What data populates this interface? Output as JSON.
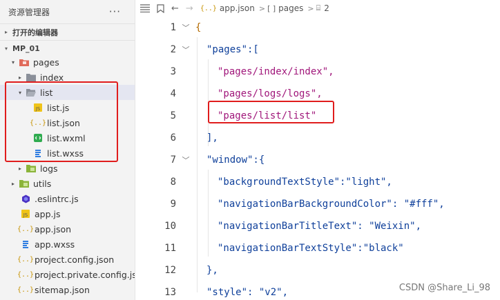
{
  "sidebar": {
    "title": "资源管理器",
    "more": "···",
    "open_editors": "打开的编辑器",
    "project": "MP_01",
    "tree": [
      {
        "label": "pages",
        "expanded": true,
        "icon": "folder-red-icon",
        "chev": "▾"
      },
      {
        "label": "index",
        "expanded": false,
        "icon": "folder-gray-icon",
        "chev": "▸"
      },
      {
        "label": "list",
        "expanded": true,
        "icon": "folder-gray-open-icon",
        "chev": "▾",
        "selected": true
      },
      {
        "label": "list.js",
        "icon": "js-file-icon"
      },
      {
        "label": "list.json",
        "icon": "json-file-icon"
      },
      {
        "label": "list.wxml",
        "icon": "wxml-file-icon"
      },
      {
        "label": "list.wxss",
        "icon": "wxss-file-icon"
      },
      {
        "label": "logs",
        "expanded": false,
        "icon": "folder-green-icon",
        "chev": "▸"
      },
      {
        "label": "utils",
        "expanded": false,
        "icon": "folder-green-icon",
        "chev": "▸"
      },
      {
        "label": ".eslintrc.js",
        "icon": "eslint-file-icon"
      },
      {
        "label": "app.js",
        "icon": "js-file-icon"
      },
      {
        "label": "app.json",
        "icon": "json-file-icon"
      },
      {
        "label": "app.wxss",
        "icon": "wxss-file-icon"
      },
      {
        "label": "project.config.json",
        "icon": "json-file-icon"
      },
      {
        "label": "project.private.config.js...",
        "icon": "json-file-icon"
      },
      {
        "label": "sitemap.json",
        "icon": "json-file-icon"
      }
    ]
  },
  "breadcrumb": {
    "file_icon": "{..}",
    "file": "app.json",
    "sep": ">",
    "array_icon": "[ ]",
    "section": "pages",
    "item_icon": "⌸",
    "item": "2"
  },
  "editor": {
    "lines": [
      {
        "n": "1",
        "text": "{"
      },
      {
        "n": "2",
        "text": "\"pages\":["
      },
      {
        "n": "3",
        "text": "\"pages/index/index\","
      },
      {
        "n": "4",
        "text": "\"pages/logs/logs\","
      },
      {
        "n": "5",
        "text": "\"pages/list/list\""
      },
      {
        "n": "6",
        "text": "],"
      },
      {
        "n": "7",
        "text": "\"window\":{"
      },
      {
        "n": "8",
        "text": "\"backgroundTextStyle\":\"light\","
      },
      {
        "n": "9",
        "text": "\"navigationBarBackgroundColor\": \"#fff\","
      },
      {
        "n": "10",
        "text": "\"navigationBarTitleText\": \"Weixin\","
      },
      {
        "n": "11",
        "text": "\"navigationBarTextStyle\":\"black\""
      },
      {
        "n": "12",
        "text": "},"
      },
      {
        "n": "13",
        "text": "\"style\": \"v2\","
      }
    ]
  },
  "watermark": "CSDN @Share_Li_98",
  "colors": {
    "accent_red": "#e01c1c",
    "key": "#0e3f9a",
    "string": "#a0167a"
  }
}
